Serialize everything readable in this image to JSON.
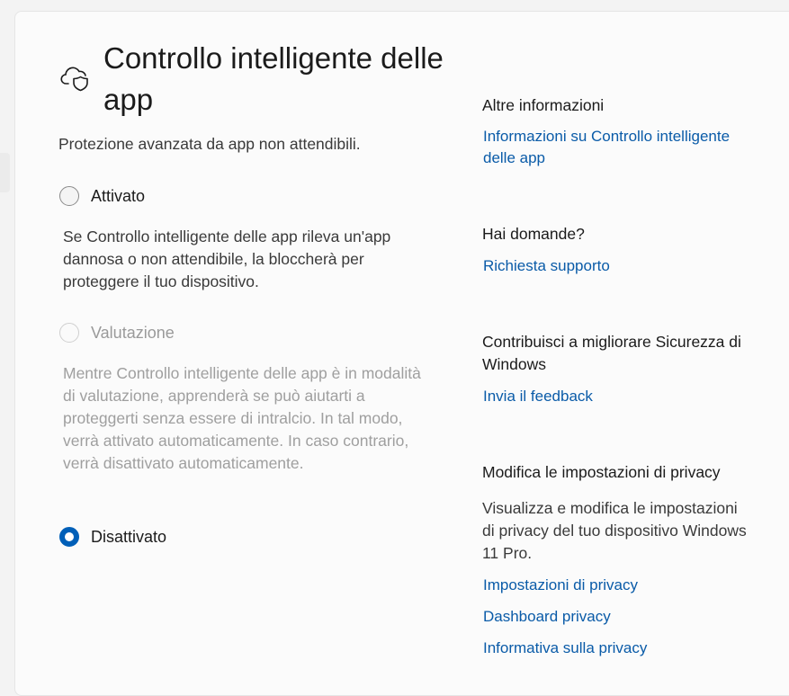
{
  "header": {
    "title": "Controllo intelligente delle app",
    "icon": "cloud-shield-icon",
    "subtitle": "Protezione avanzata da app non attendibili."
  },
  "options": [
    {
      "label": "Attivato",
      "state": "unchecked",
      "enabled": true,
      "description": "Se Controllo intelligente delle app rileva un'app dannosa o non attendibile, la bloccherà per proteggere il tuo dispositivo."
    },
    {
      "label": "Valutazione",
      "state": "unchecked",
      "enabled": false,
      "description": "Mentre Controllo intelligente delle app è in modalità di valutazione, apprenderà se può aiutarti a proteggerti senza essere di intralcio. In tal modo, verrà attivato automaticamente. In caso contrario, verrà disattivato automaticamente."
    },
    {
      "label": "Disattivato",
      "state": "checked",
      "enabled": true
    }
  ],
  "sidebar": {
    "more_info": {
      "heading": "Altre informazioni",
      "link": "Informazioni su Controllo intelligente delle app"
    },
    "questions": {
      "heading": "Hai domande?",
      "link": "Richiesta supporto"
    },
    "feedback": {
      "heading": "Contribuisci a migliorare Sicurezza di Windows",
      "link": "Invia il feedback"
    },
    "privacy": {
      "heading": "Modifica le impostazioni di privacy",
      "text": "Visualizza e modifica le impostazioni di privacy del tuo dispositivo Windows 11 Pro.",
      "links": [
        "Impostazioni di privacy",
        "Dashboard privacy",
        "Informativa sulla privacy"
      ]
    }
  },
  "colors": {
    "accent": "#005fb8",
    "link": "#0a5ba8",
    "disabled_text": "#9f9f9f"
  }
}
